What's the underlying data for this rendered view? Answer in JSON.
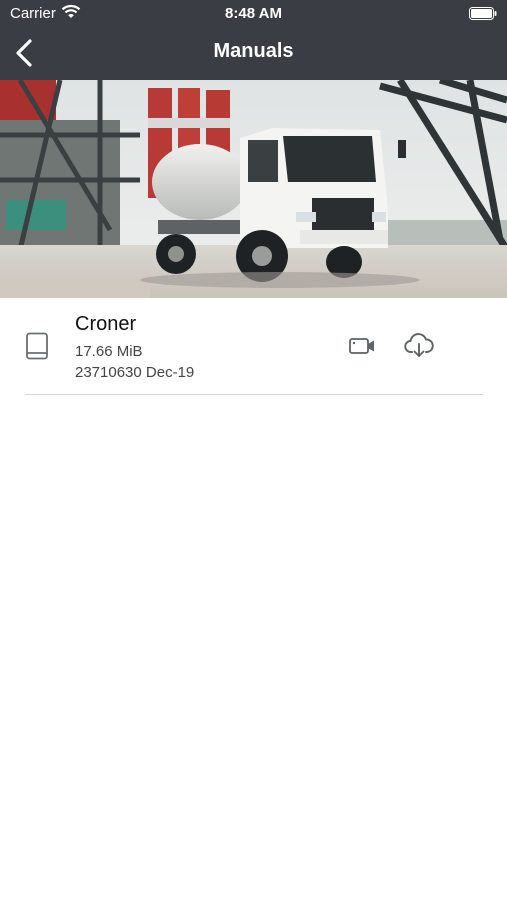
{
  "status": {
    "carrier": "Carrier",
    "time": "8:48 AM"
  },
  "nav": {
    "title": "Manuals"
  },
  "icons": {
    "back": "chevron-left-icon",
    "wifi": "wifi-icon",
    "battery": "battery-icon",
    "book": "book-icon",
    "video": "video-icon",
    "download": "cloud-download-icon"
  },
  "colors": {
    "header_bg": "#3a3d43",
    "divider": "#d5d5d5"
  },
  "manuals": [
    {
      "name": "Croner",
      "size": "17.66 MiB",
      "meta": "23710630 Dec-19"
    }
  ]
}
